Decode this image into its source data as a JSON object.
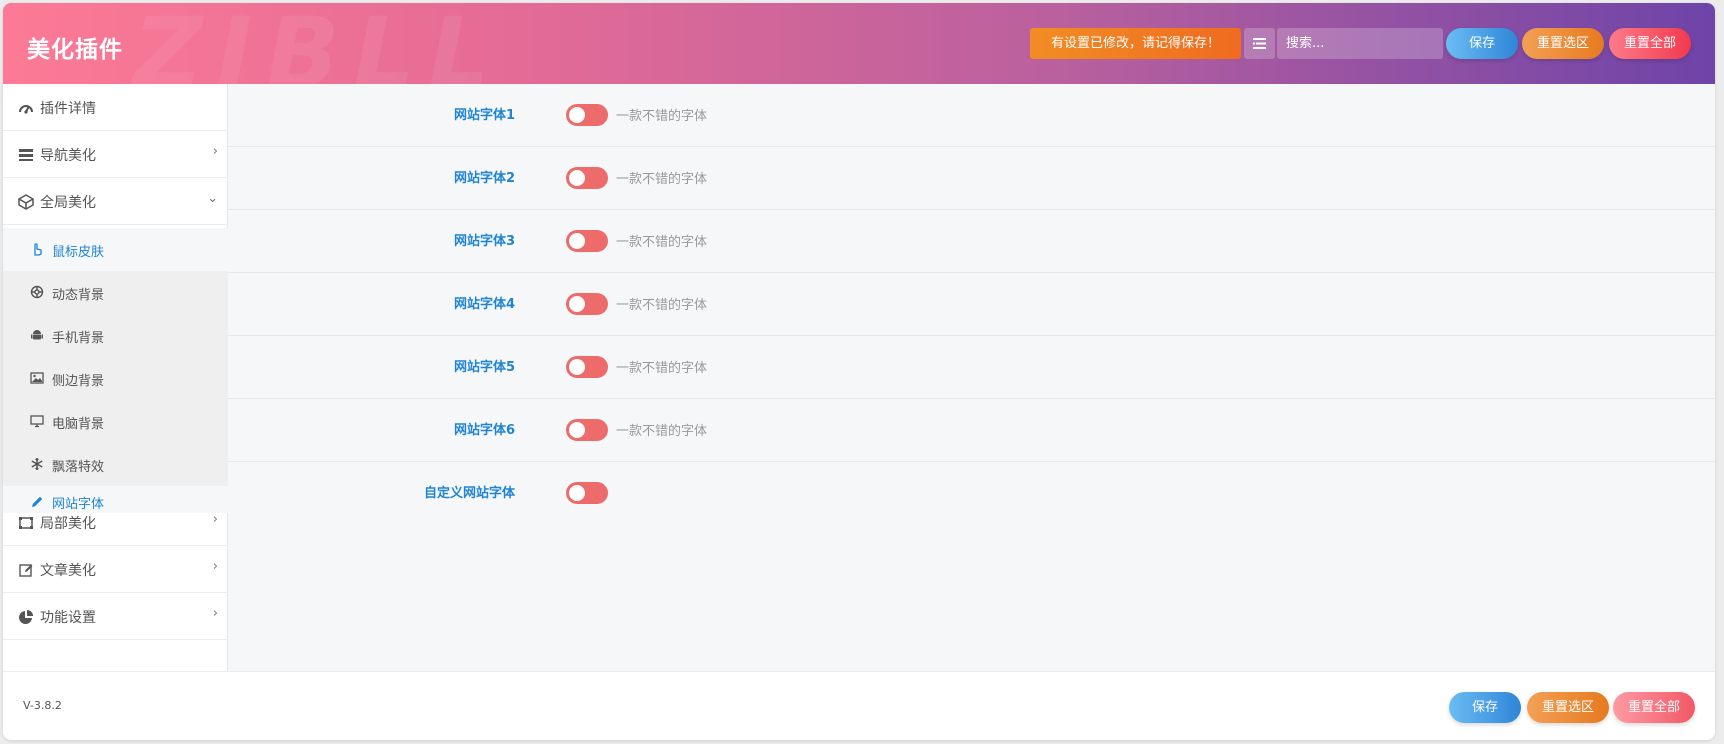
{
  "header": {
    "title": "美化插件",
    "watermark": "ZIBLL",
    "notice": "有设置已修改，请记得保存！",
    "search_placeholder": "搜索...",
    "save_label": "保存",
    "reset_section_label": "重置选区",
    "reset_all_label": "重置全部"
  },
  "sidebar": {
    "items": [
      {
        "label": "插件详情",
        "icon": "gauge-icon"
      },
      {
        "label": "导航美化",
        "icon": "list-icon",
        "chevron": "›"
      },
      {
        "label": "全局美化",
        "icon": "cube-icon",
        "chevron": "⌄"
      },
      {
        "label": "局部美化",
        "icon": "frame-icon",
        "chevron": "›"
      },
      {
        "label": "文章美化",
        "icon": "edit-icon",
        "chevron": "›"
      },
      {
        "label": "功能设置",
        "icon": "pie-chart-icon",
        "chevron": "›"
      }
    ],
    "sub_items": [
      {
        "label": "鼠标皮肤",
        "icon": "pointer-hand-icon"
      },
      {
        "label": "动态背景",
        "icon": "globe-icon"
      },
      {
        "label": "手机背景",
        "icon": "android-icon"
      },
      {
        "label": "侧边背景",
        "icon": "image-icon"
      },
      {
        "label": "电脑背景",
        "icon": "desktop-icon"
      },
      {
        "label": "飘落特效",
        "icon": "snowflake-icon"
      },
      {
        "label": "网站字体",
        "icon": "pencil-icon"
      }
    ]
  },
  "main": {
    "rows": [
      {
        "label": "网站字体1",
        "desc": "一款不错的字体",
        "enabled": false
      },
      {
        "label": "网站字体2",
        "desc": "一款不错的字体",
        "enabled": false
      },
      {
        "label": "网站字体3",
        "desc": "一款不错的字体",
        "enabled": false
      },
      {
        "label": "网站字体4",
        "desc": "一款不错的字体",
        "enabled": false
      },
      {
        "label": "网站字体5",
        "desc": "一款不错的字体",
        "enabled": false
      },
      {
        "label": "网站字体6",
        "desc": "一款不错的字体",
        "enabled": false
      },
      {
        "label": "自定义网站字体",
        "desc": "",
        "enabled": false
      }
    ]
  },
  "footer": {
    "version": "V-3.8.2",
    "save_label": "保存",
    "reset_section_label": "重置选区",
    "reset_all_label": "重置全部"
  },
  "colors": {
    "accent_blue": "#1f84d4",
    "toggle_off": "#ee6b6b",
    "notice_orange": "#ef7a22"
  }
}
